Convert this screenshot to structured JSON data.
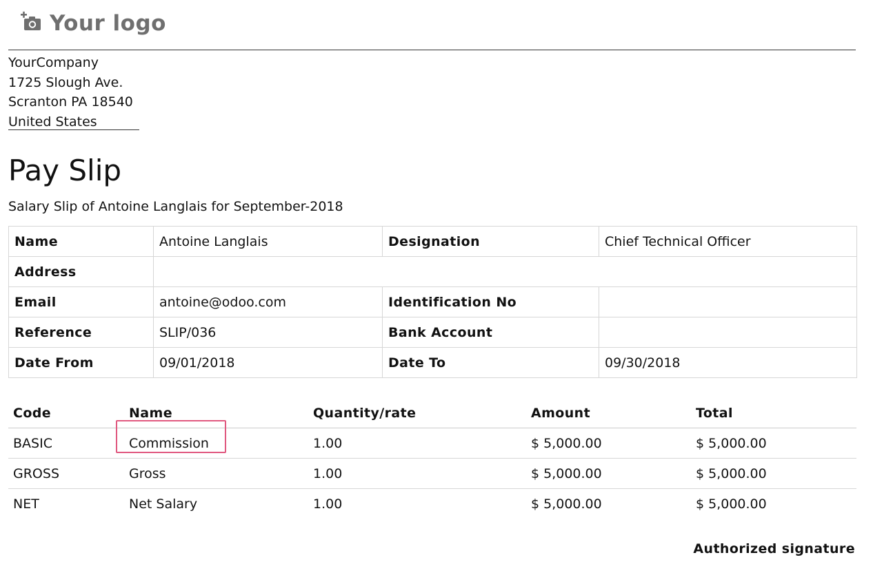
{
  "header": {
    "logo_text": "Your logo",
    "logo_icon": "camera-plus-icon"
  },
  "company": {
    "name": "YourCompany",
    "street": "1725 Slough Ave.",
    "city": "Scranton PA 18540",
    "country": "United States"
  },
  "document": {
    "title": "Pay Slip",
    "subtitle": "Salary Slip of Antoine Langlais for September-2018"
  },
  "employee_info": {
    "name_label": "Name",
    "name_value": "Antoine Langlais",
    "designation_label": "Designation",
    "designation_value": "Chief Technical Officer",
    "address_label": "Address",
    "address_value": "",
    "email_label": "Email",
    "email_value": "antoine@odoo.com",
    "identification_label": "Identification No",
    "identification_value": "",
    "reference_label": "Reference",
    "reference_value": "SLIP/036",
    "bank_label": "Bank Account",
    "bank_value": "",
    "date_from_label": "Date From",
    "date_from_value": "09/01/2018",
    "date_to_label": "Date To",
    "date_to_value": "09/30/2018"
  },
  "lines": {
    "headers": [
      "Code",
      "Name",
      "Quantity/rate",
      "Amount",
      "Total"
    ],
    "rows": [
      {
        "code": "BASIC",
        "name": "Commission",
        "qty": "1.00",
        "amount": "$ 5,000.00",
        "total": "$ 5,000.00"
      },
      {
        "code": "GROSS",
        "name": "Gross",
        "qty": "1.00",
        "amount": "$ 5,000.00",
        "total": "$ 5,000.00"
      },
      {
        "code": "NET",
        "name": "Net Salary",
        "qty": "1.00",
        "amount": "$ 5,000.00",
        "total": "$ 5,000.00"
      }
    ]
  },
  "footer": {
    "signature_label": "Authorized signature"
  },
  "colors": {
    "highlight": "#e0587f",
    "logo": "#6f6f6f"
  }
}
